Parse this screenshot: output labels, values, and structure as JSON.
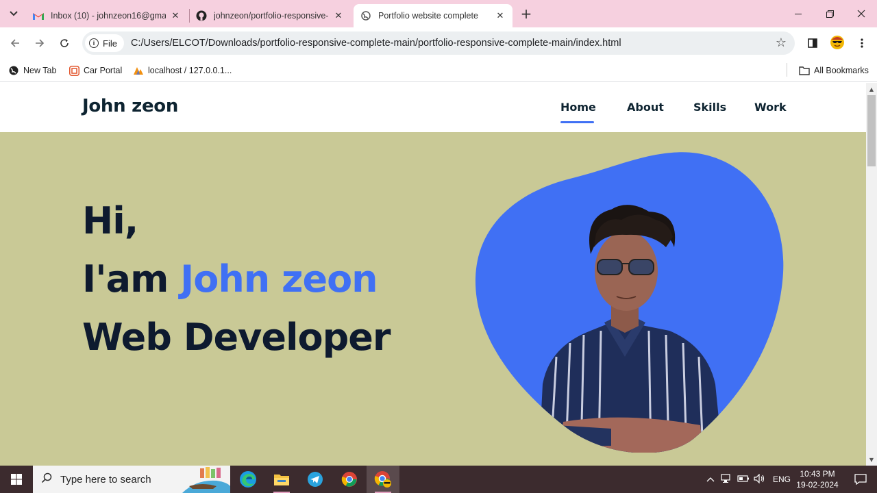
{
  "browser": {
    "tabs": [
      {
        "title": "Inbox (10) - johnzeon16@gmai",
        "icon": "gmail-icon"
      },
      {
        "title": "johnzeon/portfolio-responsive-",
        "icon": "github-icon"
      },
      {
        "title": "Portfolio website complete",
        "icon": "globe-icon",
        "active": true
      }
    ],
    "chip_label": "File",
    "url": "C:/Users/ELCOT/Downloads/portfolio-responsive-complete-main/portfolio-responsive-complete-main/index.html",
    "bookmarks": [
      {
        "label": "New Tab"
      },
      {
        "label": "Car Portal"
      },
      {
        "label": "localhost / 127.0.0.1..."
      }
    ],
    "all_bookmarks": "All Bookmarks"
  },
  "site": {
    "logo": "John zeon",
    "nav": [
      {
        "label": "Home",
        "active": true
      },
      {
        "label": "About"
      },
      {
        "label": "Skills"
      },
      {
        "label": "Work"
      }
    ],
    "hero": {
      "line1": "Hi,",
      "line2_prefix": "I'am ",
      "line2_name": "John zeon",
      "line3": "Web Developer"
    },
    "colors": {
      "background": "#c9c996",
      "accent": "#4070f4",
      "text": "#0e2431"
    }
  },
  "taskbar": {
    "search_placeholder": "Type here to search",
    "language": "ENG",
    "time": "10:43 PM",
    "date": "19-02-2024"
  }
}
